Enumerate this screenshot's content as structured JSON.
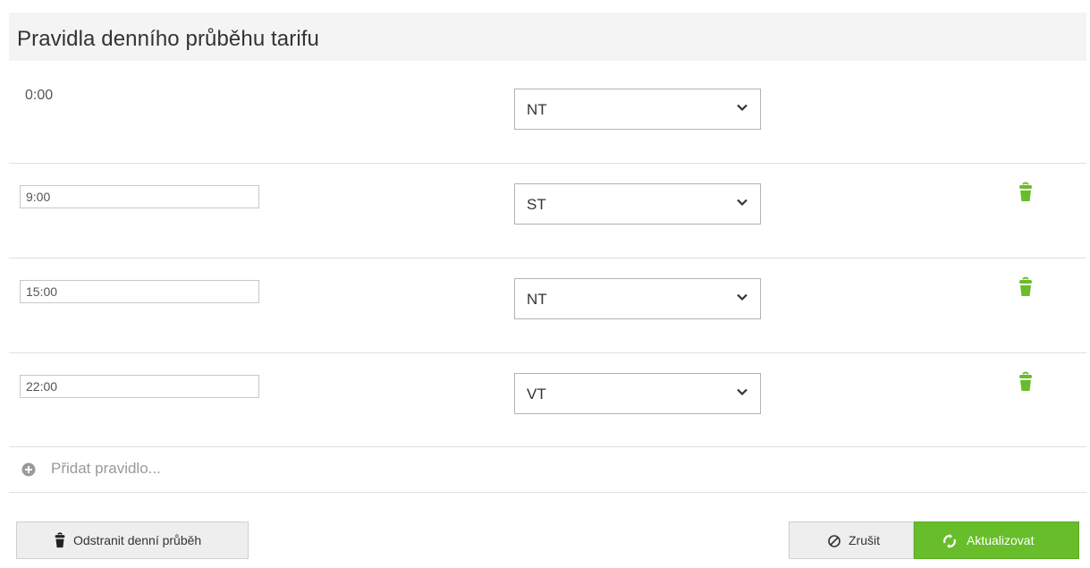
{
  "panel": {
    "title": "Pravidla denního průběhu tarifu"
  },
  "rules": [
    {
      "time": "0:00",
      "time_editable": false,
      "tariff": "NT",
      "deletable": false
    },
    {
      "time": "9:00",
      "time_editable": true,
      "tariff": "ST",
      "deletable": true
    },
    {
      "time": "15:00",
      "time_editable": true,
      "tariff": "NT",
      "deletable": true
    },
    {
      "time": "22:00",
      "time_editable": true,
      "tariff": "VT",
      "deletable": true
    }
  ],
  "add_rule": {
    "label": "Přidat pravidlo...",
    "icon": "plus-circle-icon"
  },
  "actions": {
    "remove_label": "Odstranit denní průběh",
    "remove_icon": "trash-icon",
    "cancel_label": "Zrušit",
    "cancel_icon": "cancel-circle-icon",
    "update_label": "Aktualizovat",
    "update_icon": "refresh-icon"
  },
  "colors": {
    "accent_green": "#67bd2a",
    "header_bg": "#f4f4f4",
    "muted_text": "#9a9a9a"
  }
}
